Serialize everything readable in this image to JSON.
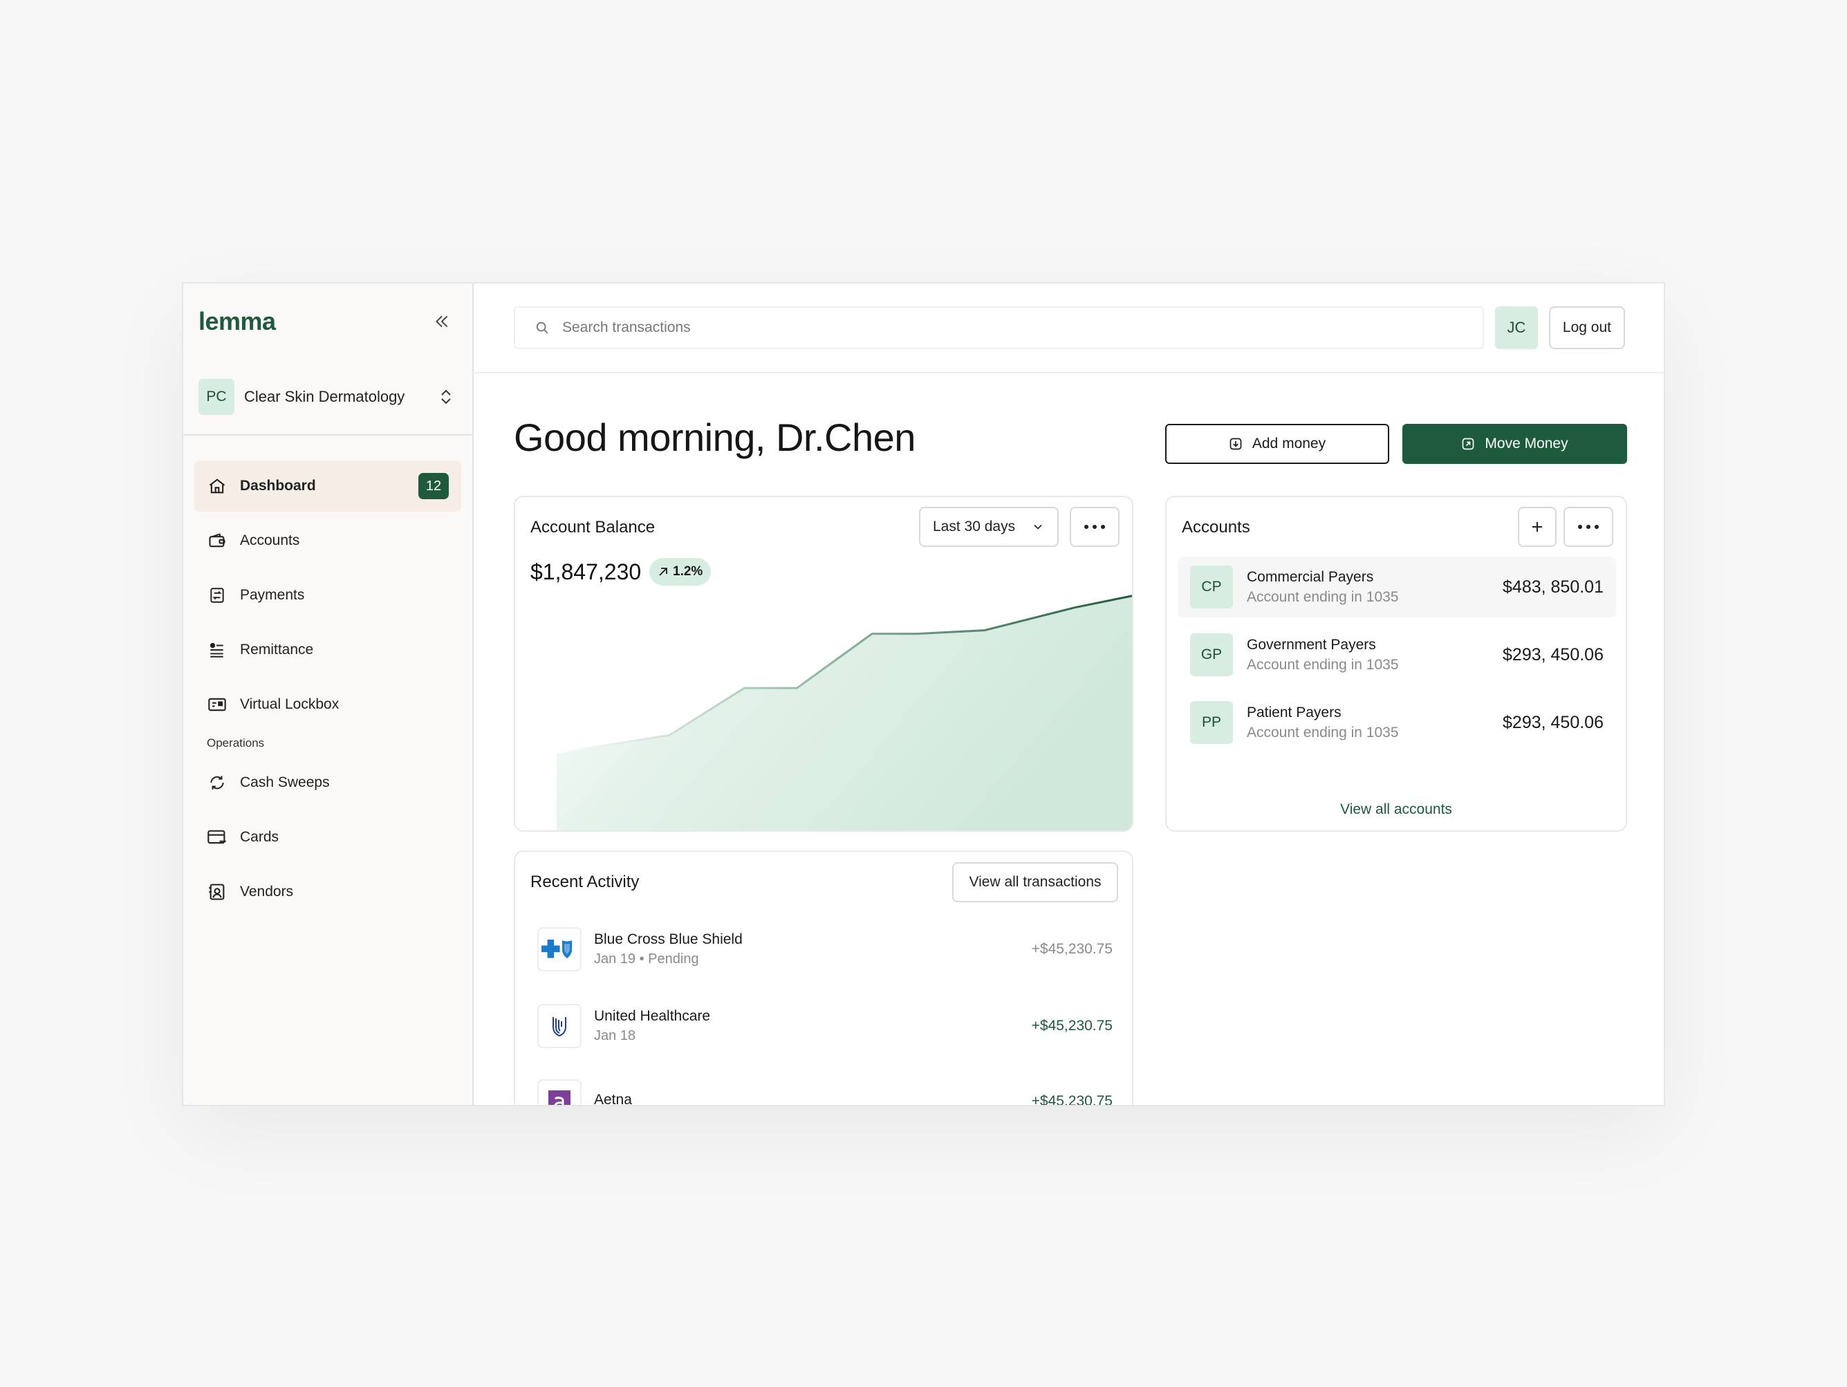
{
  "brand": "lemma",
  "org": {
    "initials": "PC",
    "name": "Clear Skin Dermatology"
  },
  "nav": {
    "items": [
      {
        "label": "Dashboard",
        "badge": "12"
      },
      {
        "label": "Accounts"
      },
      {
        "label": "Payments"
      },
      {
        "label": "Remittance"
      },
      {
        "label": "Virtual Lockbox"
      }
    ],
    "section_label": "Operations",
    "ops_items": [
      {
        "label": "Cash Sweeps"
      },
      {
        "label": "Cards"
      },
      {
        "label": "Vendors"
      }
    ]
  },
  "topbar": {
    "search_placeholder": "Search transactions",
    "user_initials": "JC",
    "logout_label": "Log out"
  },
  "greeting": "Good morning, Dr.Chen",
  "actions": {
    "add_money": "Add money",
    "move_money": "Move Money"
  },
  "balance_card": {
    "title": "Account Balance",
    "range_label": "Last 30 days",
    "value": "$1,847,230",
    "change": "1.2%"
  },
  "chart_data": {
    "type": "area",
    "x": [
      0,
      1,
      2,
      3,
      4,
      5,
      6,
      7,
      8
    ],
    "values": [
      0.1,
      0.2,
      0.47,
      0.47,
      0.78,
      0.78,
      0.8,
      0.93,
      1.0
    ],
    "grid": false,
    "legend": "none"
  },
  "accounts_card": {
    "title": "Accounts",
    "items": [
      {
        "initials": "CP",
        "name": "Commercial Payers",
        "sub": "Account ending in 1035",
        "amount": "$483, 850.01"
      },
      {
        "initials": "GP",
        "name": "Government Payers",
        "sub": "Account ending in 1035",
        "amount": "$293, 450.06"
      },
      {
        "initials": "PP",
        "name": "Patient Payers",
        "sub": "Account ending in 1035",
        "amount": "$293, 450.06"
      }
    ],
    "view_all": "View all accounts"
  },
  "activity_card": {
    "title": "Recent Activity",
    "view_all": "View all transactions",
    "items": [
      {
        "name": "Blue Cross Blue Shield",
        "sub": "Jan 19 • Pending",
        "amount": "+$45,230.75"
      },
      {
        "name": "United Healthcare",
        "sub": "Jan 18",
        "amount": "+$45,230.75"
      },
      {
        "name": "Aetna",
        "sub": "",
        "amount": "+$45,230.75"
      }
    ]
  },
  "colors": {
    "brand": "#1f5a3e",
    "accent_light": "#d8ede2",
    "active_nav": "#f6eee6",
    "amount_pending": "#8a8a8a",
    "amount_positive": "#1e5a3e"
  }
}
